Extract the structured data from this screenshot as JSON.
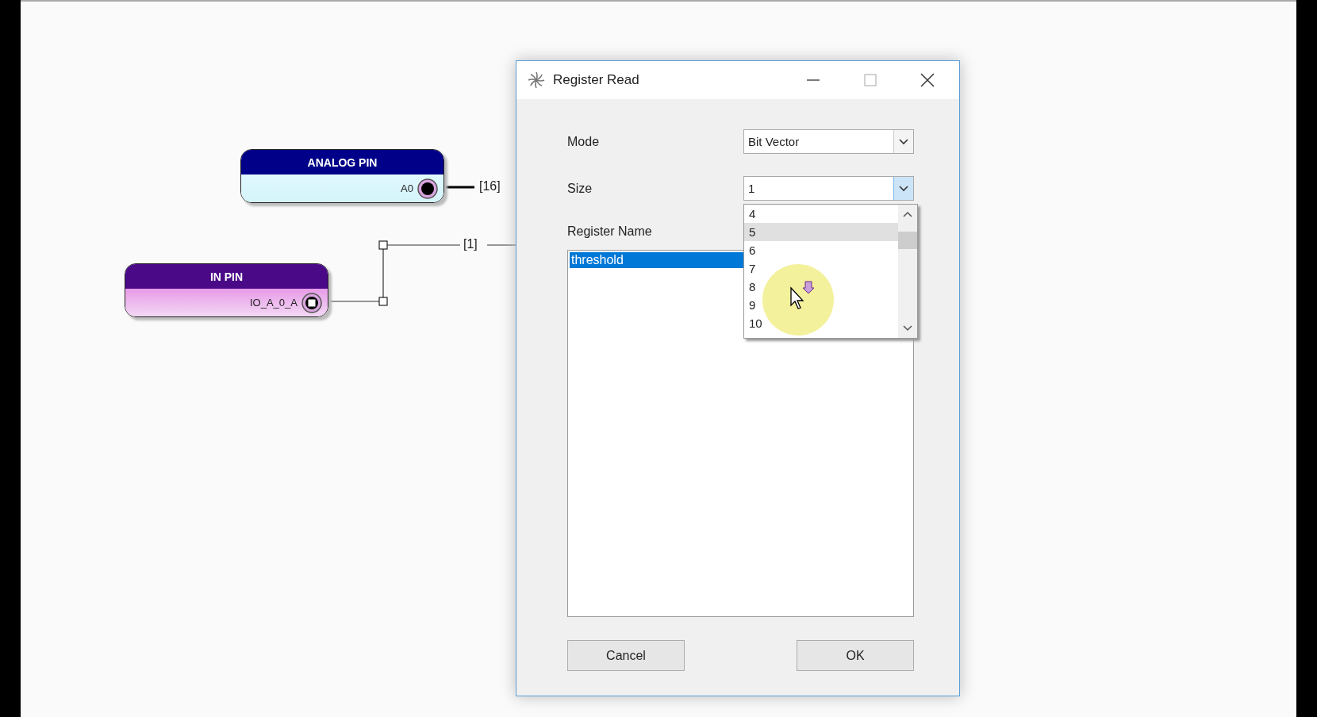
{
  "canvas": {
    "nodes": [
      {
        "title": "ANALOG PIN",
        "port": "A0",
        "kind": "analog"
      },
      {
        "title": "IN PIN",
        "port": "IO_A_0_A",
        "kind": "digital"
      }
    ],
    "wires": [
      {
        "label": "[16]",
        "kind": "bus"
      },
      {
        "label": "[1]",
        "kind": "single"
      }
    ]
  },
  "dialog": {
    "title": "Register Read",
    "fields": [
      {
        "label": "Mode",
        "value": "Bit Vector",
        "open": false
      },
      {
        "label": "Size",
        "value": "1",
        "open": true
      }
    ],
    "size_options": [
      {
        "label": "4",
        "selected": false
      },
      {
        "label": "5",
        "selected": true
      },
      {
        "label": "6",
        "selected": false
      },
      {
        "label": "7",
        "selected": false
      },
      {
        "label": "8",
        "selected": false
      },
      {
        "label": "9",
        "selected": false
      },
      {
        "label": "10",
        "selected": false
      }
    ],
    "register_label": "Register Name",
    "registers": [
      {
        "name": "threshold",
        "selected": true
      }
    ],
    "buttons": [
      "Cancel",
      "OK"
    ]
  }
}
